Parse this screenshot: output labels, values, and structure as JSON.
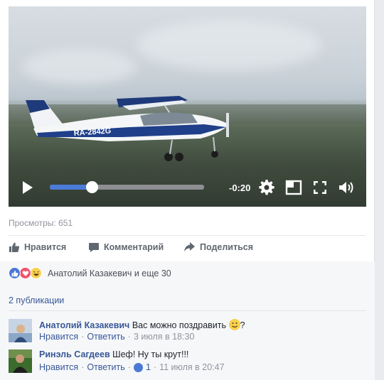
{
  "video": {
    "plane_registration": "RA-2842G",
    "time_remaining": "-0:20",
    "progress": 0.27
  },
  "stats": {
    "views": "Просмотры: 651"
  },
  "actions": {
    "like_label": "Нравится",
    "comment_label": "Комментарий",
    "share_label": "Поделиться"
  },
  "reactions": {
    "summary": "Анатолий Казакевич и еще 30",
    "types": [
      "like-icon",
      "love-icon",
      "haha-icon"
    ]
  },
  "publications": "2 публикации",
  "comments": [
    {
      "author": "Анатолий Казакевич",
      "text_before": "Вас можно поздравить ",
      "text_after": "?",
      "like": "Нравится",
      "reply": "Ответить",
      "date": "3 июля в 18:30"
    },
    {
      "author": "Ринэль Сагдеев",
      "text": "Шеф! Ну ты крут!!!",
      "like": "Нравится",
      "reply": "Ответить",
      "likes_count": "1",
      "date": "11 июля в 20:47"
    }
  ],
  "colors": {
    "link": "#385898",
    "progress": "#4a7bd8",
    "muted": "#90949c"
  }
}
